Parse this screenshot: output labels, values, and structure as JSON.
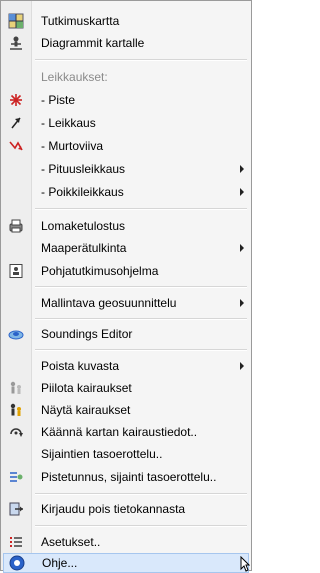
{
  "menu": {
    "tutkimuskartta": "Tutkimuskartta",
    "diagrammit": "Diagrammit kartalle",
    "leikkaukset_header": "Leikkaukset:",
    "piste": "- Piste",
    "leikkaus": "- Leikkaus",
    "murtoviiva": "- Murtoviiva",
    "pituusleikkaus": "- Pituusleikkaus",
    "poikkileikkaus": "- Poikkileikkaus",
    "lomaketulostus": "Lomaketulostus",
    "maaperatulkinta": "Maaperätulkinta",
    "pohjatutkimusohjelma": "Pohjatutkimusohjelma",
    "mallintava": "Mallintava geosuunnittelu",
    "soundings": "Soundings Editor",
    "poista_kuvasta": "Poista kuvasta",
    "piilota": "Piilota kairaukset",
    "nayta": "Näytä kairaukset",
    "kaanna": "Käännä kartan kairaustiedot..",
    "sijaintien": "Sijaintien tasoerottelu..",
    "pistetunnus": "Pistetunnus, sijainti tasoerottelu..",
    "kirjaudu": "Kirjaudu pois tietokannasta",
    "asetukset": "Asetukset..",
    "ohje": "Ohje..."
  },
  "icons": {
    "tutkimuskartta": "map-grid-icon",
    "diagrammit": "diagram-person-icon",
    "piste": "point-star-icon",
    "leikkaus": "section-arrow-icon",
    "murtoviiva": "polyline-icon",
    "lomaketulostus": "print-form-icon",
    "pohjatutkimusohjelma": "program-document-icon",
    "soundings": "soundings-editor-icon",
    "piilota": "hide-soundings-icon",
    "nayta": "show-soundings-icon",
    "kaanna": "rotate-icon",
    "pistetunnus": "point-id-icon",
    "kirjaudu": "logout-icon",
    "asetukset": "settings-list-icon",
    "ohje": "help-icon"
  },
  "colors": {
    "accent_red": "#cc2222",
    "accent_blue": "#2a62c9",
    "hover_bg": "#d9e8fb"
  }
}
